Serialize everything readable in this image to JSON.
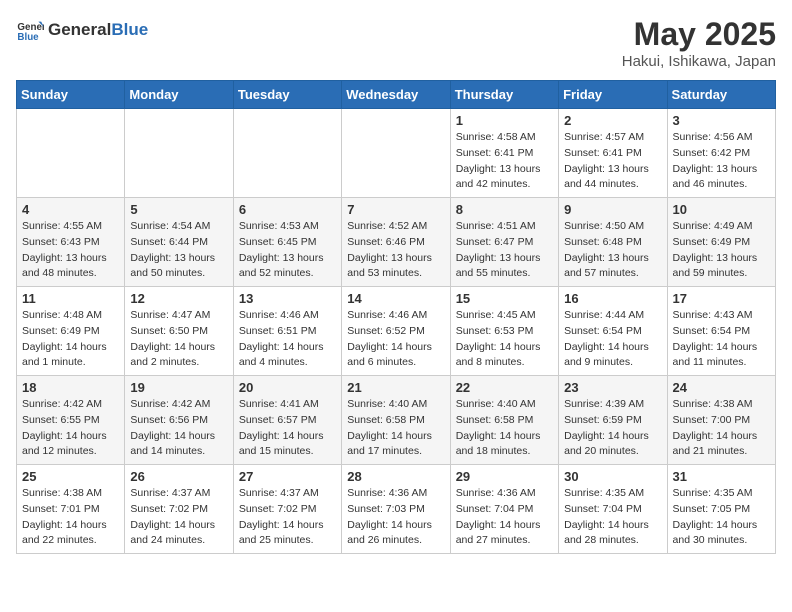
{
  "header": {
    "logo_general": "General",
    "logo_blue": "Blue",
    "month": "May 2025",
    "location": "Hakui, Ishikawa, Japan"
  },
  "weekdays": [
    "Sunday",
    "Monday",
    "Tuesday",
    "Wednesday",
    "Thursday",
    "Friday",
    "Saturday"
  ],
  "weeks": [
    [
      {
        "day": "",
        "info": ""
      },
      {
        "day": "",
        "info": ""
      },
      {
        "day": "",
        "info": ""
      },
      {
        "day": "",
        "info": ""
      },
      {
        "day": "1",
        "info": "Sunrise: 4:58 AM\nSunset: 6:41 PM\nDaylight: 13 hours\nand 42 minutes."
      },
      {
        "day": "2",
        "info": "Sunrise: 4:57 AM\nSunset: 6:41 PM\nDaylight: 13 hours\nand 44 minutes."
      },
      {
        "day": "3",
        "info": "Sunrise: 4:56 AM\nSunset: 6:42 PM\nDaylight: 13 hours\nand 46 minutes."
      }
    ],
    [
      {
        "day": "4",
        "info": "Sunrise: 4:55 AM\nSunset: 6:43 PM\nDaylight: 13 hours\nand 48 minutes."
      },
      {
        "day": "5",
        "info": "Sunrise: 4:54 AM\nSunset: 6:44 PM\nDaylight: 13 hours\nand 50 minutes."
      },
      {
        "day": "6",
        "info": "Sunrise: 4:53 AM\nSunset: 6:45 PM\nDaylight: 13 hours\nand 52 minutes."
      },
      {
        "day": "7",
        "info": "Sunrise: 4:52 AM\nSunset: 6:46 PM\nDaylight: 13 hours\nand 53 minutes."
      },
      {
        "day": "8",
        "info": "Sunrise: 4:51 AM\nSunset: 6:47 PM\nDaylight: 13 hours\nand 55 minutes."
      },
      {
        "day": "9",
        "info": "Sunrise: 4:50 AM\nSunset: 6:48 PM\nDaylight: 13 hours\nand 57 minutes."
      },
      {
        "day": "10",
        "info": "Sunrise: 4:49 AM\nSunset: 6:49 PM\nDaylight: 13 hours\nand 59 minutes."
      }
    ],
    [
      {
        "day": "11",
        "info": "Sunrise: 4:48 AM\nSunset: 6:49 PM\nDaylight: 14 hours\nand 1 minute."
      },
      {
        "day": "12",
        "info": "Sunrise: 4:47 AM\nSunset: 6:50 PM\nDaylight: 14 hours\nand 2 minutes."
      },
      {
        "day": "13",
        "info": "Sunrise: 4:46 AM\nSunset: 6:51 PM\nDaylight: 14 hours\nand 4 minutes."
      },
      {
        "day": "14",
        "info": "Sunrise: 4:46 AM\nSunset: 6:52 PM\nDaylight: 14 hours\nand 6 minutes."
      },
      {
        "day": "15",
        "info": "Sunrise: 4:45 AM\nSunset: 6:53 PM\nDaylight: 14 hours\nand 8 minutes."
      },
      {
        "day": "16",
        "info": "Sunrise: 4:44 AM\nSunset: 6:54 PM\nDaylight: 14 hours\nand 9 minutes."
      },
      {
        "day": "17",
        "info": "Sunrise: 4:43 AM\nSunset: 6:54 PM\nDaylight: 14 hours\nand 11 minutes."
      }
    ],
    [
      {
        "day": "18",
        "info": "Sunrise: 4:42 AM\nSunset: 6:55 PM\nDaylight: 14 hours\nand 12 minutes."
      },
      {
        "day": "19",
        "info": "Sunrise: 4:42 AM\nSunset: 6:56 PM\nDaylight: 14 hours\nand 14 minutes."
      },
      {
        "day": "20",
        "info": "Sunrise: 4:41 AM\nSunset: 6:57 PM\nDaylight: 14 hours\nand 15 minutes."
      },
      {
        "day": "21",
        "info": "Sunrise: 4:40 AM\nSunset: 6:58 PM\nDaylight: 14 hours\nand 17 minutes."
      },
      {
        "day": "22",
        "info": "Sunrise: 4:40 AM\nSunset: 6:58 PM\nDaylight: 14 hours\nand 18 minutes."
      },
      {
        "day": "23",
        "info": "Sunrise: 4:39 AM\nSunset: 6:59 PM\nDaylight: 14 hours\nand 20 minutes."
      },
      {
        "day": "24",
        "info": "Sunrise: 4:38 AM\nSunset: 7:00 PM\nDaylight: 14 hours\nand 21 minutes."
      }
    ],
    [
      {
        "day": "25",
        "info": "Sunrise: 4:38 AM\nSunset: 7:01 PM\nDaylight: 14 hours\nand 22 minutes."
      },
      {
        "day": "26",
        "info": "Sunrise: 4:37 AM\nSunset: 7:02 PM\nDaylight: 14 hours\nand 24 minutes."
      },
      {
        "day": "27",
        "info": "Sunrise: 4:37 AM\nSunset: 7:02 PM\nDaylight: 14 hours\nand 25 minutes."
      },
      {
        "day": "28",
        "info": "Sunrise: 4:36 AM\nSunset: 7:03 PM\nDaylight: 14 hours\nand 26 minutes."
      },
      {
        "day": "29",
        "info": "Sunrise: 4:36 AM\nSunset: 7:04 PM\nDaylight: 14 hours\nand 27 minutes."
      },
      {
        "day": "30",
        "info": "Sunrise: 4:35 AM\nSunset: 7:04 PM\nDaylight: 14 hours\nand 28 minutes."
      },
      {
        "day": "31",
        "info": "Sunrise: 4:35 AM\nSunset: 7:05 PM\nDaylight: 14 hours\nand 30 minutes."
      }
    ]
  ]
}
